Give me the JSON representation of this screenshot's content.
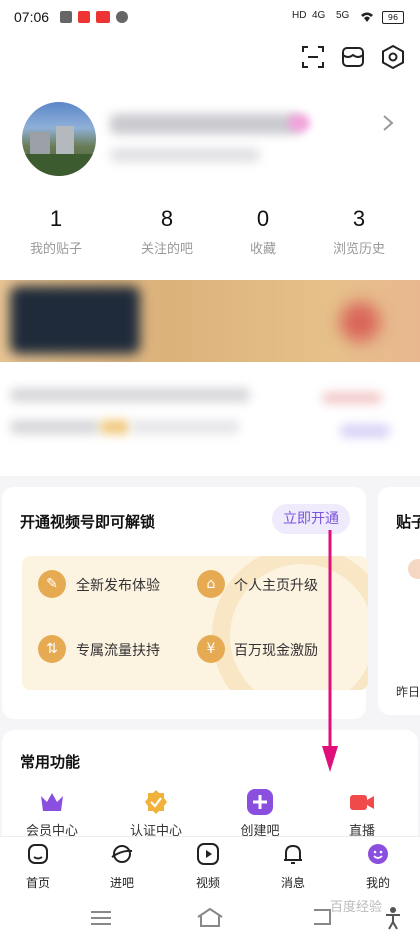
{
  "status_bar": {
    "time": "07:06",
    "network": "4G",
    "network2": "5G",
    "battery": "96"
  },
  "profile": {
    "stats": [
      {
        "value": "1",
        "label": "我的贴子"
      },
      {
        "value": "8",
        "label": "关注的吧"
      },
      {
        "value": "0",
        "label": "收藏"
      },
      {
        "value": "3",
        "label": "浏览历史"
      }
    ]
  },
  "unlock_card": {
    "title": "开通视频号即可解锁",
    "button": "立即开通",
    "perks": [
      {
        "label": "全新发布体验",
        "icon": "pencil-icon"
      },
      {
        "label": "个人主页升级",
        "icon": "home-up-icon"
      },
      {
        "label": "专属流量扶持",
        "icon": "traffic-icon"
      },
      {
        "label": "百万现金激励",
        "icon": "yuan-icon"
      }
    ]
  },
  "side_card": {
    "title": "贴子",
    "sub": "昨日"
  },
  "common_functions": {
    "title": "常用功能",
    "items": [
      {
        "label": "会员中心",
        "icon": "crown-icon",
        "color": "#8b4fe0"
      },
      {
        "label": "认证中心",
        "icon": "badge-check-icon",
        "color": "#f0b23a"
      },
      {
        "label": "创建吧",
        "icon": "plus-icon",
        "color": "#8b4fe0"
      },
      {
        "label": "直播",
        "icon": "video-camera-icon",
        "color": "#f04a4a"
      }
    ]
  },
  "bottom_nav": [
    {
      "label": "首页",
      "icon": "home-icon"
    },
    {
      "label": "进吧",
      "icon": "planet-icon"
    },
    {
      "label": "视频",
      "icon": "play-icon"
    },
    {
      "label": "消息",
      "icon": "bell-icon"
    },
    {
      "label": "我的",
      "icon": "smile-icon",
      "active": true
    }
  ],
  "watermark": "百度经验"
}
